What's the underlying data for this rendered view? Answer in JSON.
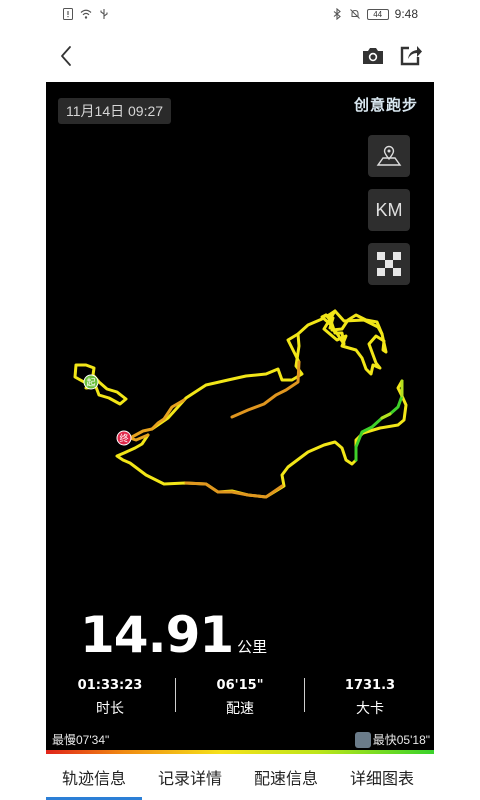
{
  "status_bar": {
    "battery": "44",
    "time": "9:48"
  },
  "session": {
    "datetime": "11月14日 09:27",
    "brand": "创意跑步"
  },
  "map_controls": {
    "unit_label": "KM"
  },
  "markers": {
    "start": "起",
    "end": "终"
  },
  "summary": {
    "distance": "14.91",
    "distance_unit": "公里"
  },
  "stats": [
    {
      "value": "01:33:23",
      "label": "时长"
    },
    {
      "value": "06'15\"",
      "label": "配速"
    },
    {
      "value": "1731.3",
      "label": "大卡"
    }
  ],
  "pace_legend": {
    "slowest": "最慢07'34\"",
    "fastest": "最快05'18\""
  },
  "tabs": [
    {
      "label": "轨迹信息",
      "active": true
    },
    {
      "label": "记录详情",
      "active": false
    },
    {
      "label": "配速信息",
      "active": false
    },
    {
      "label": "详细图表",
      "active": false
    }
  ],
  "colors": {
    "track_yellow": "#f2e618",
    "track_orange": "#e7a21f",
    "track_green": "#3fd12a",
    "accent": "#2c7fd6"
  }
}
